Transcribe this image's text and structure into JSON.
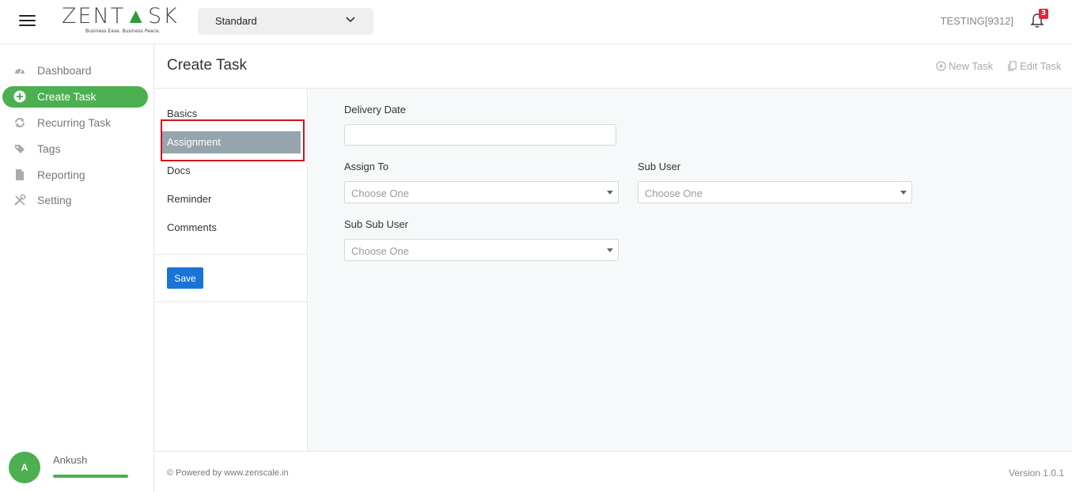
{
  "topbar": {
    "logo": {
      "part1": "ZENT",
      "part2": "SK",
      "tagline": "Business Ease. Business Peace."
    },
    "plan_select": {
      "value": "Standard"
    },
    "user_code": "TESTING[9312]",
    "notification_count": "3"
  },
  "sidebar": {
    "items": [
      {
        "label": "Dashboard",
        "icon": "dashboard-icon"
      },
      {
        "label": "Create Task",
        "icon": "plus-circle-icon",
        "active": true
      },
      {
        "label": "Recurring Task",
        "icon": "refresh-icon"
      },
      {
        "label": "Tags",
        "icon": "tag-icon"
      },
      {
        "label": "Reporting",
        "icon": "document-icon"
      },
      {
        "label": "Setting",
        "icon": "tools-icon"
      }
    ],
    "profile": {
      "initial": "A",
      "name": "Ankush"
    }
  },
  "page": {
    "title": "Create Task",
    "actions": {
      "new_task": "New Task",
      "edit_task": "Edit Task"
    }
  },
  "sections": {
    "items": [
      "Basics",
      "Assignment",
      "Docs",
      "Reminder",
      "Comments"
    ],
    "active": "Assignment",
    "save_label": "Save"
  },
  "form": {
    "delivery_date": {
      "label": "Delivery Date",
      "value": ""
    },
    "assign_to": {
      "label": "Assign To",
      "placeholder": "Choose One"
    },
    "sub_user": {
      "label": "Sub User",
      "placeholder": "Choose One"
    },
    "sub_sub_user": {
      "label": "Sub Sub User",
      "placeholder": "Choose One"
    }
  },
  "footer": {
    "powered_by": "© Powered by www.zenscale.in",
    "version": "Version 1.0.1"
  },
  "colors": {
    "accent_green": "#4caf50",
    "primary_blue": "#1a73d9",
    "badge_red": "#e0263b",
    "section_active": "#96a4ad",
    "highlight_red": "#d0141b"
  }
}
